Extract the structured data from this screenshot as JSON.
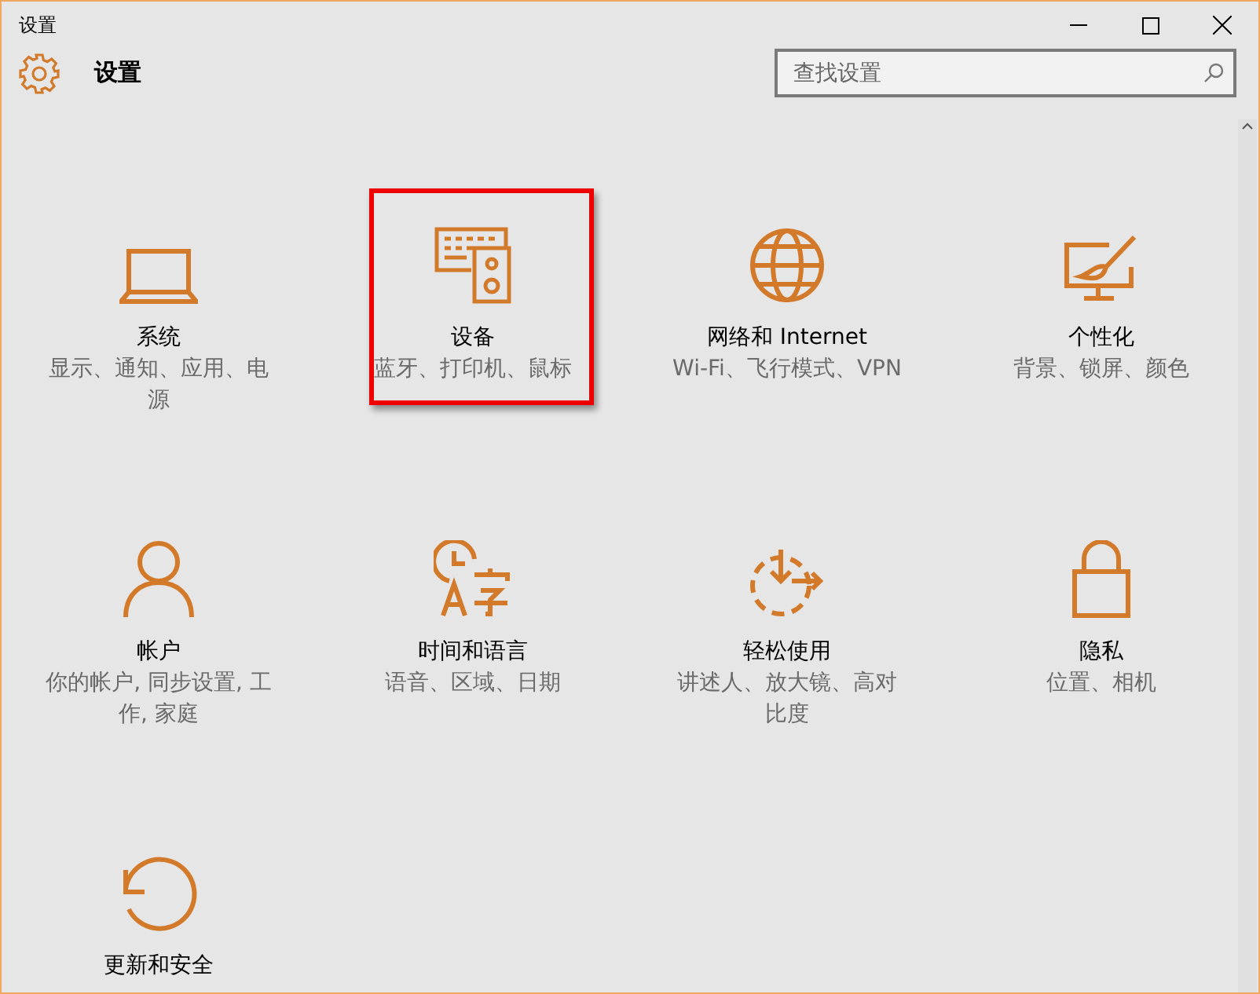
{
  "window": {
    "title": "设置"
  },
  "header": {
    "title": "设置",
    "search": {
      "placeholder": "查找设置"
    }
  },
  "tiles": [
    {
      "kind": "laptop",
      "title": "系统",
      "subtitle": "显示、通知、应用、电源",
      "highlighted": false
    },
    {
      "kind": "devices",
      "title": "设备",
      "subtitle": "蓝牙、打印机、鼠标",
      "highlighted": true
    },
    {
      "kind": "globe",
      "title": "网络和 Internet",
      "subtitle": "Wi-Fi、飞行模式、VPN",
      "highlighted": false
    },
    {
      "kind": "paint",
      "title": "个性化",
      "subtitle": "背景、锁屏、颜色",
      "highlighted": false
    },
    {
      "kind": "person",
      "title": "帐户",
      "subtitle": "你的帐户, 同步设置, 工作, 家庭",
      "highlighted": false
    },
    {
      "kind": "timelang",
      "title": "时间和语言",
      "subtitle": "语音、区域、日期",
      "highlighted": false
    },
    {
      "kind": "ease",
      "title": "轻松使用",
      "subtitle": "讲述人、放大镜、高对比度",
      "highlighted": false
    },
    {
      "kind": "lock",
      "title": "隐私",
      "subtitle": "位置、相机",
      "highlighted": false
    },
    {
      "kind": "update",
      "title": "更新和安全",
      "highlighted": false
    }
  ]
}
